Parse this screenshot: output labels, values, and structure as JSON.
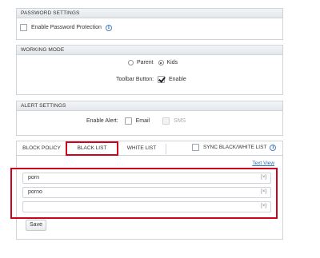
{
  "password_settings": {
    "header": "PASSWORD SETTINGS",
    "enable_label": "Enable Password Protection"
  },
  "working_mode": {
    "header": "WORKING MODE",
    "parent_label": "Parent",
    "kids_label": "Kids",
    "selected_mode": "Kids",
    "toolbar_label": "Toolbar Button:",
    "toolbar_enable_label": "Enable",
    "toolbar_enabled": true
  },
  "alert_settings": {
    "header": "ALERT SETTINGS",
    "enable_alert_label": "Enable Alert:",
    "email_label": "Email",
    "sms_label": "SMS"
  },
  "tabs": {
    "block_policy": "BLOCK POLICY",
    "black_list": "BLACK LIST",
    "white_list": "WHITE LIST",
    "active": "BLACK LIST"
  },
  "sync_label": "SYNC BLACK/WHITE LIST",
  "text_view_link": "Text View",
  "blacklist": {
    "items": [
      "porn",
      "porno",
      ""
    ],
    "remove_label": "[×]"
  },
  "save_label": "Save",
  "highlight_color": "#d0021b"
}
